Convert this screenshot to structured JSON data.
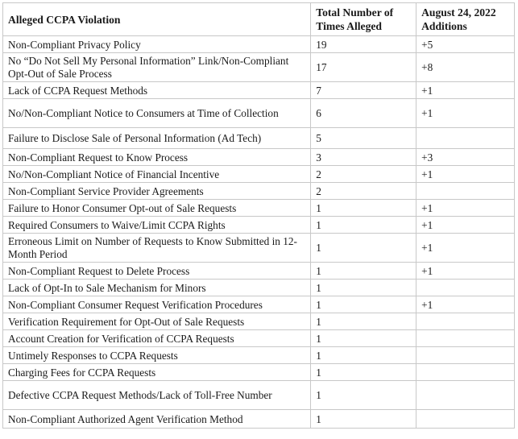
{
  "table": {
    "headers": [
      "Alleged CCPA Violation",
      "Total Number of Times Alleged",
      "August 24, 2022 Additions"
    ],
    "rows": [
      {
        "violation": "Non-Compliant Privacy Policy",
        "total": "19",
        "additions": "+5"
      },
      {
        "violation": "No “Do Not Sell My Personal Information” Link/Non-Compliant Opt-Out of Sale Process",
        "total": "17",
        "additions": "+8"
      },
      {
        "violation": "Lack of CCPA Request Methods",
        "total": "7",
        "additions": "+1"
      },
      {
        "violation": "No/Non-Compliant Notice to Consumers at Time of Collection",
        "total": "6",
        "additions": "+1"
      },
      {
        "violation": "Failure to Disclose Sale of Personal Information (Ad Tech)",
        "total": "5",
        "additions": ""
      },
      {
        "violation": "Non-Compliant Request to Know Process",
        "total": "3",
        "additions": "+3"
      },
      {
        "violation": "No/Non-Compliant Notice of Financial Incentive",
        "total": "2",
        "additions": "+1"
      },
      {
        "violation": "Non-Compliant Service Provider Agreements",
        "total": "2",
        "additions": ""
      },
      {
        "violation": "Failure to Honor Consumer Opt-out of Sale Requests",
        "total": "1",
        "additions": "+1"
      },
      {
        "violation": "Required Consumers to Waive/Limit CCPA Rights",
        "total": "1",
        "additions": "+1"
      },
      {
        "violation": "Erroneous Limit on Number of Requests to Know Submitted in 12-Month Period",
        "total": "1",
        "additions": "+1"
      },
      {
        "violation": "Non-Compliant Request to Delete Process",
        "total": "1",
        "additions": "+1"
      },
      {
        "violation": "Lack of Opt-In to Sale Mechanism for Minors",
        "total": "1",
        "additions": ""
      },
      {
        "violation": "Non-Compliant Consumer Request Verification Procedures",
        "total": "1",
        "additions": "+1"
      },
      {
        "violation": "Verification Requirement for Opt-Out of Sale Requests",
        "total": "1",
        "additions": ""
      },
      {
        "violation": "Account Creation for Verification of CCPA Requests",
        "total": "1",
        "additions": ""
      },
      {
        "violation": "Untimely Responses to CCPA Requests",
        "total": "1",
        "additions": ""
      },
      {
        "violation": "Charging Fees for CCPA Requests",
        "total": "1",
        "additions": ""
      },
      {
        "violation": "Defective CCPA Request Methods/Lack of Toll-Free Number",
        "total": "1",
        "additions": ""
      },
      {
        "violation": "Non-Compliant Authorized Agent Verification Method",
        "total": "1",
        "additions": ""
      }
    ]
  }
}
